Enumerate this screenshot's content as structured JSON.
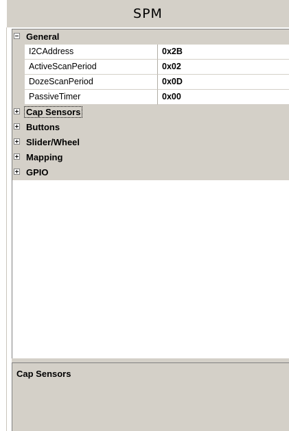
{
  "title": "SPM",
  "property_grid": {
    "categories": [
      {
        "label": "General",
        "expanded": true,
        "properties": [
          {
            "name": "I2CAddress",
            "value": "0x2B"
          },
          {
            "name": "ActiveScanPeriod",
            "value": "0x02"
          },
          {
            "name": "DozeScanPeriod",
            "value": "0x0D"
          },
          {
            "name": "PassiveTimer",
            "value": "0x00"
          }
        ]
      },
      {
        "label": "Cap Sensors",
        "expanded": false,
        "selected": true
      },
      {
        "label": "Buttons",
        "expanded": false
      },
      {
        "label": "Slider/Wheel",
        "expanded": false
      },
      {
        "label": "Mapping",
        "expanded": false
      },
      {
        "label": "GPIO",
        "expanded": false
      }
    ]
  },
  "description": {
    "title": "Cap Sensors"
  },
  "colors": {
    "panel_gray": "#d4d0c8",
    "border": "#808080"
  }
}
